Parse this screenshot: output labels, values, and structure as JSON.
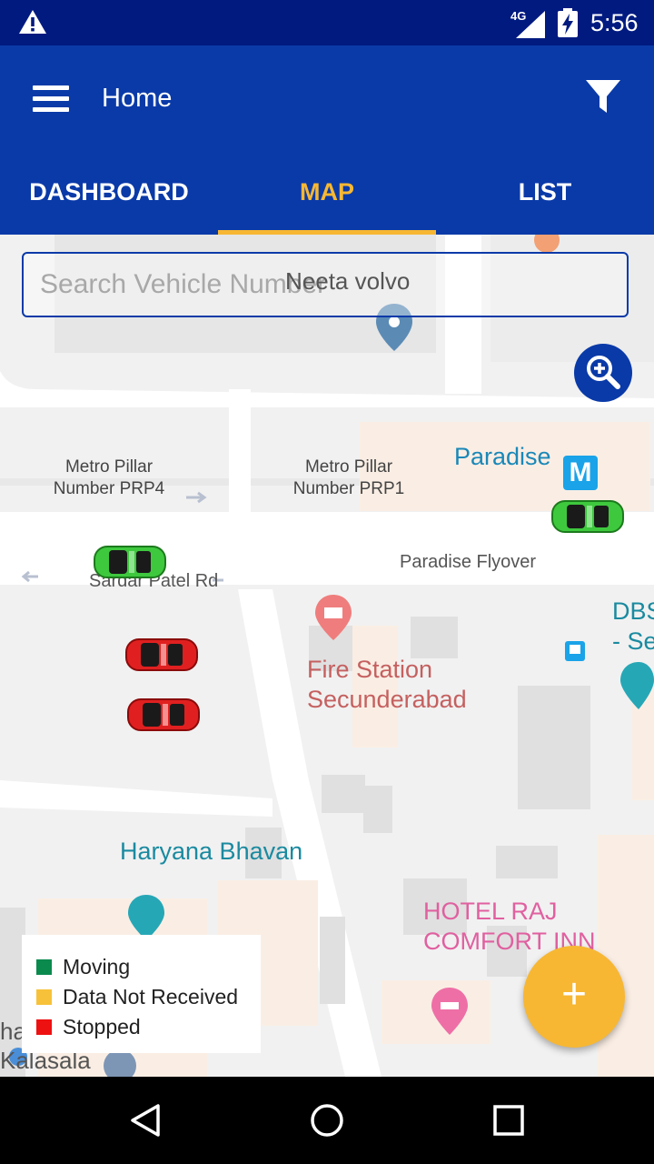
{
  "status_bar": {
    "network": "4G",
    "time": "5:56"
  },
  "appbar": {
    "title": "Home"
  },
  "tabs": [
    {
      "label": "DASHBOARD",
      "active": false
    },
    {
      "label": "MAP",
      "active": true
    },
    {
      "label": "LIST",
      "active": false
    }
  ],
  "search": {
    "placeholder": "Search Vehicle Number",
    "value": ""
  },
  "map": {
    "vehicle_label": "Neeta volvo",
    "labels": {
      "metro_prp4": "Metro Pillar\nNumber PRP4",
      "metro_prp1": "Metro Pillar\nNumber PRP1",
      "paradise": "Paradise",
      "metro_badge": "M",
      "paradise_flyover": "Paradise Flyover",
      "sardar_patel": "Sardar Patel Rd",
      "fire_station": "Fire Station\nSecunderabad",
      "dbs": "DBS\n- Se",
      "haryana": "Haryana Bhavan",
      "hotel": "HOTEL RAJ\nCOMFORT INN",
      "kalasala": "ha\nKalasala"
    },
    "vehicles": [
      {
        "status": "moving"
      },
      {
        "status": "moving"
      },
      {
        "status": "stopped"
      },
      {
        "status": "stopped"
      }
    ]
  },
  "legend": {
    "items": [
      {
        "label": "Moving",
        "color": "#0b8a4e"
      },
      {
        "label": "Data Not Received",
        "color": "#f7c23a"
      },
      {
        "label": "Stopped",
        "color": "#ee1111"
      }
    ]
  },
  "colors": {
    "primary": "#0a3aa8",
    "accent": "#f7b733",
    "status_bar": "#001a80"
  },
  "icons": {
    "menu": "menu-icon",
    "filter": "filter-icon",
    "zoom": "zoom-in-icon",
    "fab": "plus-icon"
  }
}
